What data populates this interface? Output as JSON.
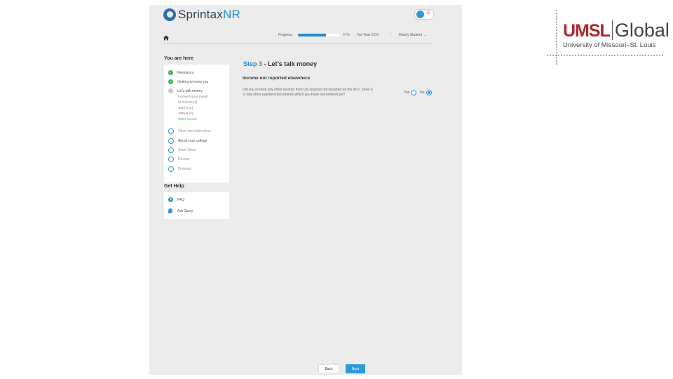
{
  "header": {
    "brand_prefix": "Sprintax",
    "brand_suffix": "NR",
    "toggle_label": "3)",
    "progress_label": "Progress",
    "progress_fraction": 0.67,
    "progress_text": "67%",
    "tax_year_label": "Tax Year",
    "tax_year_value": "2020",
    "user_label": "Hourly Student"
  },
  "sidebar": {
    "you_are_here": "You are here",
    "steps": [
      {
        "label": "Residency",
        "status": "done"
      },
      {
        "label": "Getting to know you",
        "status": "done"
      },
      {
        "label": "Let's talk money",
        "status": "current"
      },
      {
        "label": "Other tax information",
        "status": "todo"
      },
      {
        "label": "About your college",
        "status": "todo"
      },
      {
        "label": "State Taxes",
        "status": "todo"
      },
      {
        "label": "Review",
        "status": "todo"
      },
      {
        "label": "Finished",
        "status": "todo"
      }
    ],
    "substeps": [
      {
        "label": "Income Forms Import"
      },
      {
        "label": "W-2 forms (1)"
      },
      {
        "label": "1042-S (1)"
      },
      {
        "label": "1099-B (2)"
      },
      {
        "label": "Other income"
      }
    ],
    "get_help": "Get Help",
    "help_items": [
      {
        "label": "FAQ",
        "icon": "question-icon"
      },
      {
        "label": "Ask Stacy",
        "icon": "chat-icon"
      }
    ]
  },
  "main": {
    "step_num": "Step 3",
    "step_title": " - Let's talk money",
    "section_title": "Income not reported elsewhere",
    "question": "Did you receive any other income from US sources not reported on the W-2, 1042-S or any other payment documents which you have not entered yet?",
    "yes_label": "Yes",
    "no_label": "No",
    "selected": "No"
  },
  "footer": {
    "back_label": "Back",
    "next_label": "Next"
  },
  "badge": {
    "umsl": "UMSL",
    "global": "Global",
    "subtitle": "University of Missouri–St. Louis"
  },
  "colors": {
    "accent": "#1f8fcf",
    "done": "#3db54a",
    "umsl_red": "#b0262f"
  }
}
